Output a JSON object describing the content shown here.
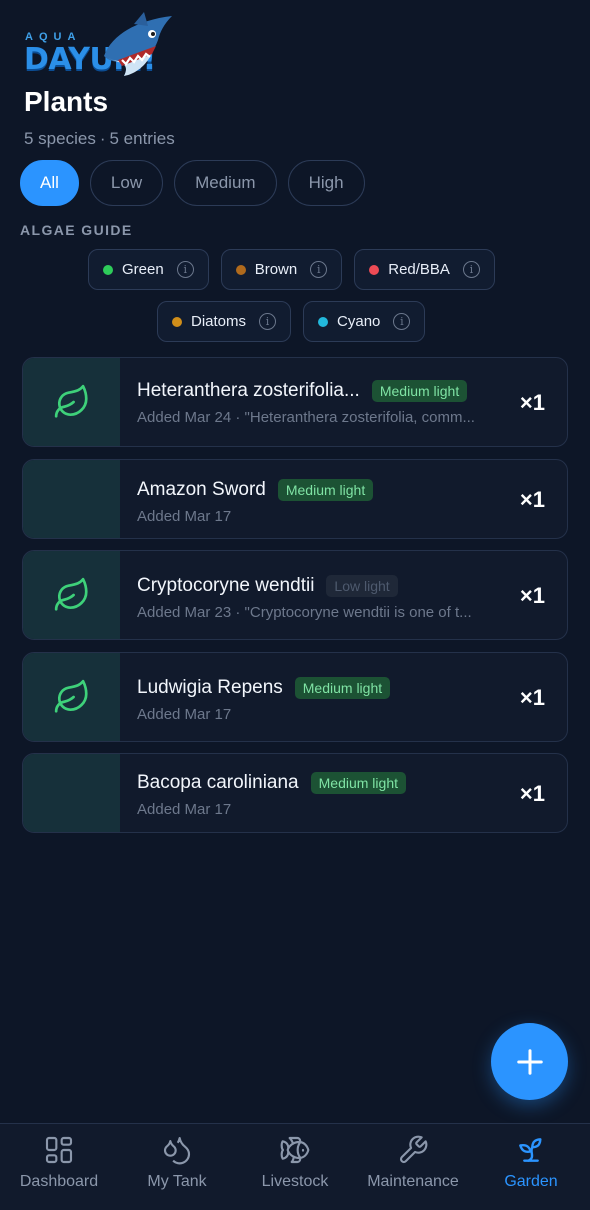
{
  "app": {
    "logo_top": "AQUA",
    "logo_main": "DAYUM!"
  },
  "header": {
    "title": "Plants",
    "species": "5 species",
    "separator": "·",
    "entries": "5 entries"
  },
  "filters": [
    {
      "label": "All",
      "active": true
    },
    {
      "label": "Low",
      "active": false
    },
    {
      "label": "Medium",
      "active": false
    },
    {
      "label": "High",
      "active": false
    }
  ],
  "algae_guide": {
    "label": "ALGAE GUIDE",
    "items": [
      {
        "label": "Green",
        "color": "#2ecc5a"
      },
      {
        "label": "Brown",
        "color": "#b06a1c"
      },
      {
        "label": "Red/BBA",
        "color": "#ee4b55"
      },
      {
        "label": "Diatoms",
        "color": "#d08e1a"
      },
      {
        "label": "Cyano",
        "color": "#22b8dc"
      }
    ],
    "info_glyph": "i"
  },
  "plants": [
    {
      "name": "Heteranthera zosterifolia...",
      "light": "Medium light",
      "meta": "Added Mar 24 · \"Heteranthera zosterifolia, comm...",
      "qty": "×1",
      "thumb": "leaf-icon"
    },
    {
      "name": "Amazon Sword",
      "light": "Medium light",
      "meta": "Added Mar 17",
      "qty": "×1",
      "thumb": "photo"
    },
    {
      "name": "Cryptocoryne wendtii",
      "light": "Low light",
      "meta": "Added Mar 23 · \"Cryptocoryne wendtii is one of t...",
      "qty": "×1",
      "thumb": "leaf-icon"
    },
    {
      "name": "Ludwigia Repens",
      "light": "Medium light",
      "meta": "Added Mar 17",
      "qty": "×1",
      "thumb": "leaf-icon"
    },
    {
      "name": "Bacopa caroliniana",
      "light": "Medium light",
      "meta": "Added Mar 17",
      "qty": "×1",
      "thumb": "photo"
    }
  ],
  "fab": {
    "icon": "plus-icon"
  },
  "nav": [
    {
      "label": "Dashboard",
      "icon": "dashboard-icon",
      "active": false
    },
    {
      "label": "My Tank",
      "icon": "water-drops-icon",
      "active": false
    },
    {
      "label": "Livestock",
      "icon": "fish-icon",
      "active": false
    },
    {
      "label": "Maintenance",
      "icon": "wrench-icon",
      "active": false
    },
    {
      "label": "Garden",
      "icon": "sprout-icon",
      "active": true
    }
  ],
  "colors": {
    "background": "#0d1627",
    "accent": "#2b94ff",
    "medium_badge_bg": "#1c5234",
    "medium_badge_text": "#7fe3a4"
  }
}
